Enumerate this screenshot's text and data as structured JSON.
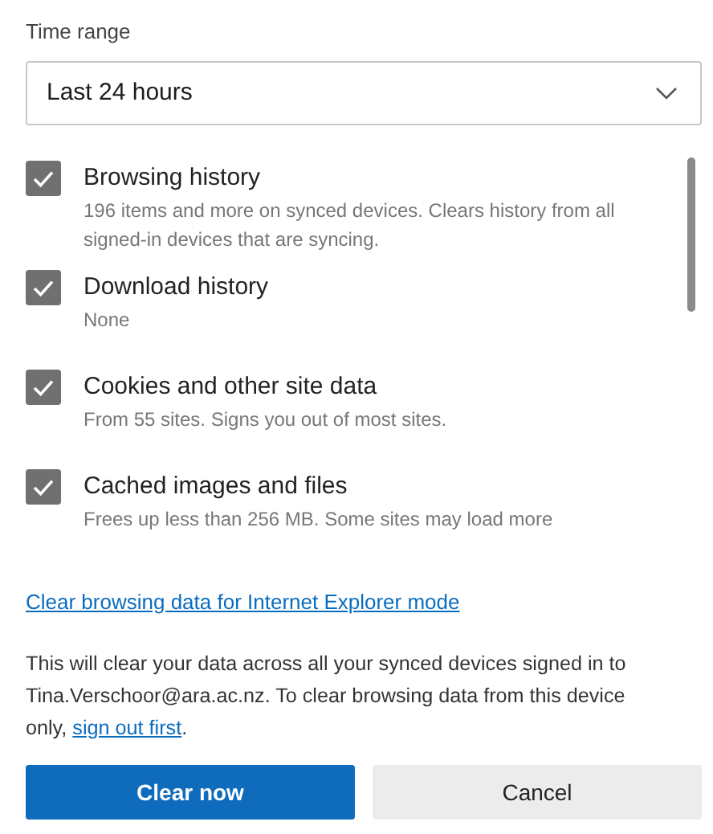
{
  "time_range": {
    "label": "Time range",
    "value": "Last 24 hours"
  },
  "items": [
    {
      "title": "Browsing history",
      "description": "196 items and more on synced devices. Clears history from all signed-in devices that are syncing.",
      "checked": true
    },
    {
      "title": "Download history",
      "description": "None",
      "checked": true
    },
    {
      "title": "Cookies and other site data",
      "description": "From 55 sites. Signs you out of most sites.",
      "checked": true
    },
    {
      "title": "Cached images and files",
      "description": "Frees up less than 256 MB. Some sites may load more",
      "checked": true
    }
  ],
  "ie_link": "Clear browsing data for Internet Explorer mode",
  "notice": {
    "text": "This will clear your data across all your synced devices signed in to Tina.Verschoor@ara.ac.nz. To clear browsing data from this device only,",
    "link": "sign out first",
    "end": "."
  },
  "buttons": [
    {
      "label": "Clear now",
      "kind": "primary"
    },
    {
      "label": "Cancel",
      "kind": "secondary"
    }
  ]
}
